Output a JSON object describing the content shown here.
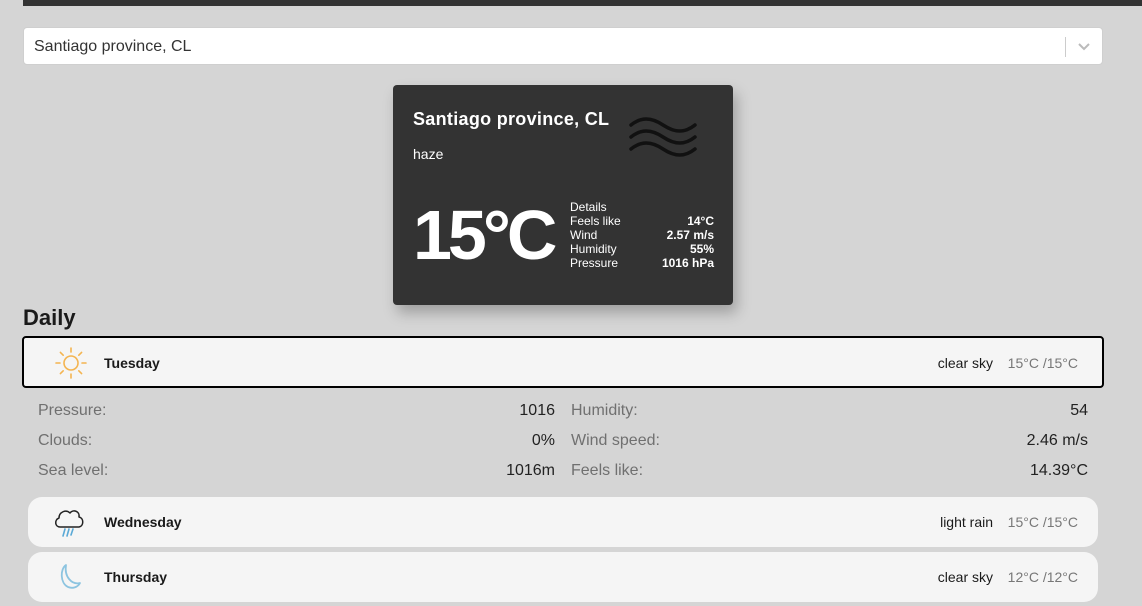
{
  "search": {
    "value": "Santiago province, CL"
  },
  "current": {
    "city": "Santiago province, CL",
    "description": "haze",
    "temperature": "15°C",
    "icon": "haze-icon",
    "details_title": "Details",
    "details": [
      {
        "label": "Feels like",
        "value": "14°C"
      },
      {
        "label": "Wind",
        "value": "2.57 m/s"
      },
      {
        "label": "Humidity",
        "value": "55%"
      },
      {
        "label": "Pressure",
        "value": "1016 hPa"
      }
    ]
  },
  "daily": {
    "title": "Daily",
    "days": [
      {
        "name": "Tuesday",
        "description": "clear sky",
        "range": "15°C /15°C",
        "icon": "sun-icon",
        "expanded": true
      },
      {
        "name": "Wednesday",
        "description": "light rain",
        "range": "15°C /15°C",
        "icon": "rain-cloud-icon"
      },
      {
        "name": "Thursday",
        "description": "clear sky",
        "range": "12°C /12°C",
        "icon": "moon-icon"
      }
    ],
    "expanded_details": [
      [
        {
          "label": "Pressure:",
          "value": "1016"
        },
        {
          "label": "Humidity:",
          "value": "54"
        }
      ],
      [
        {
          "label": "Clouds:",
          "value": "0%"
        },
        {
          "label": "Wind speed:",
          "value": "2.46 m/s"
        }
      ],
      [
        {
          "label": "Sea level:",
          "value": "1016m"
        },
        {
          "label": "Feels like:",
          "value": "14.39°C"
        }
      ]
    ]
  },
  "colors": {
    "card_bg": "#333333",
    "page_bg": "#d5d5d5",
    "sun": "#f4b450",
    "rain": "#5aa9d6",
    "moon": "#8cc4e0"
  }
}
